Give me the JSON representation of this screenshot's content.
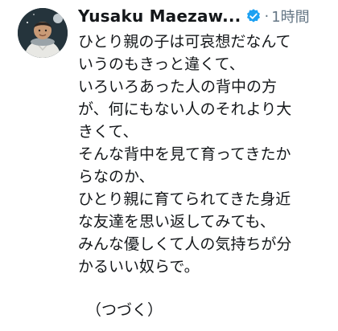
{
  "tweet": {
    "author_name": "Yusaku Maezaw...",
    "separator": "·",
    "timestamp": "1時間",
    "lines": [
      "ひとり親の子は可哀想だなんて",
      "いうのもきっと違くて、",
      "いろいろあった人の背中の方",
      "が、何にもない人のそれより大",
      "きくて、",
      "そんな背中を見て育ってきたか",
      "らなのか、",
      "ひとり親に育てられてきた身近",
      "な友達を思い返してみても、",
      "みんな優しくて人の気持ちが分",
      "かるいい奴らで。"
    ],
    "closing": "（つづく）"
  },
  "icons": {
    "avatar": "avatar-astronaut",
    "verified": "verified-badge-icon"
  },
  "colors": {
    "text": "#14171a",
    "muted": "#657786",
    "verified": "#1da1f2",
    "background": "#ffffff"
  }
}
